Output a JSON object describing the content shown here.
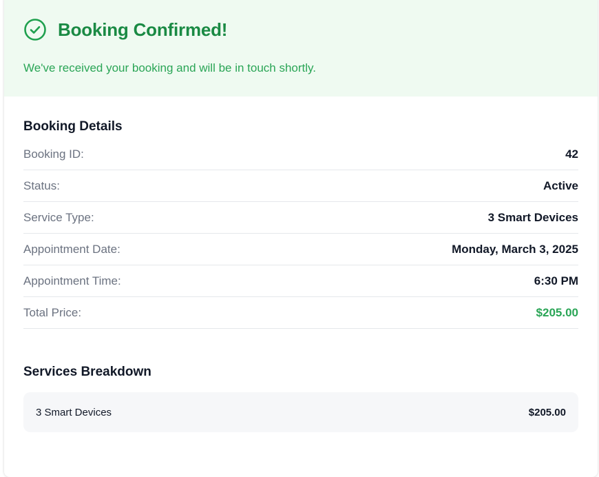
{
  "header": {
    "icon": "check-circle-icon",
    "title": "Booking Confirmed!",
    "subtitle": "We've received your booking and will be in touch shortly.",
    "accent_color": "#1a8a44",
    "background_color": "#effaf1"
  },
  "details": {
    "title": "Booking Details",
    "rows": [
      {
        "label": "Booking ID:",
        "value": "42"
      },
      {
        "label": "Status:",
        "value": "Active"
      },
      {
        "label": "Service Type:",
        "value": "3 Smart Devices"
      },
      {
        "label": "Appointment Date:",
        "value": "Monday, March 3, 2025"
      },
      {
        "label": "Appointment Time:",
        "value": "6:30 PM"
      },
      {
        "label": "Total Price:",
        "value": "$205.00"
      }
    ]
  },
  "breakdown": {
    "title": "Services Breakdown",
    "items": [
      {
        "name": "3 Smart Devices",
        "price": "$205.00"
      }
    ]
  }
}
